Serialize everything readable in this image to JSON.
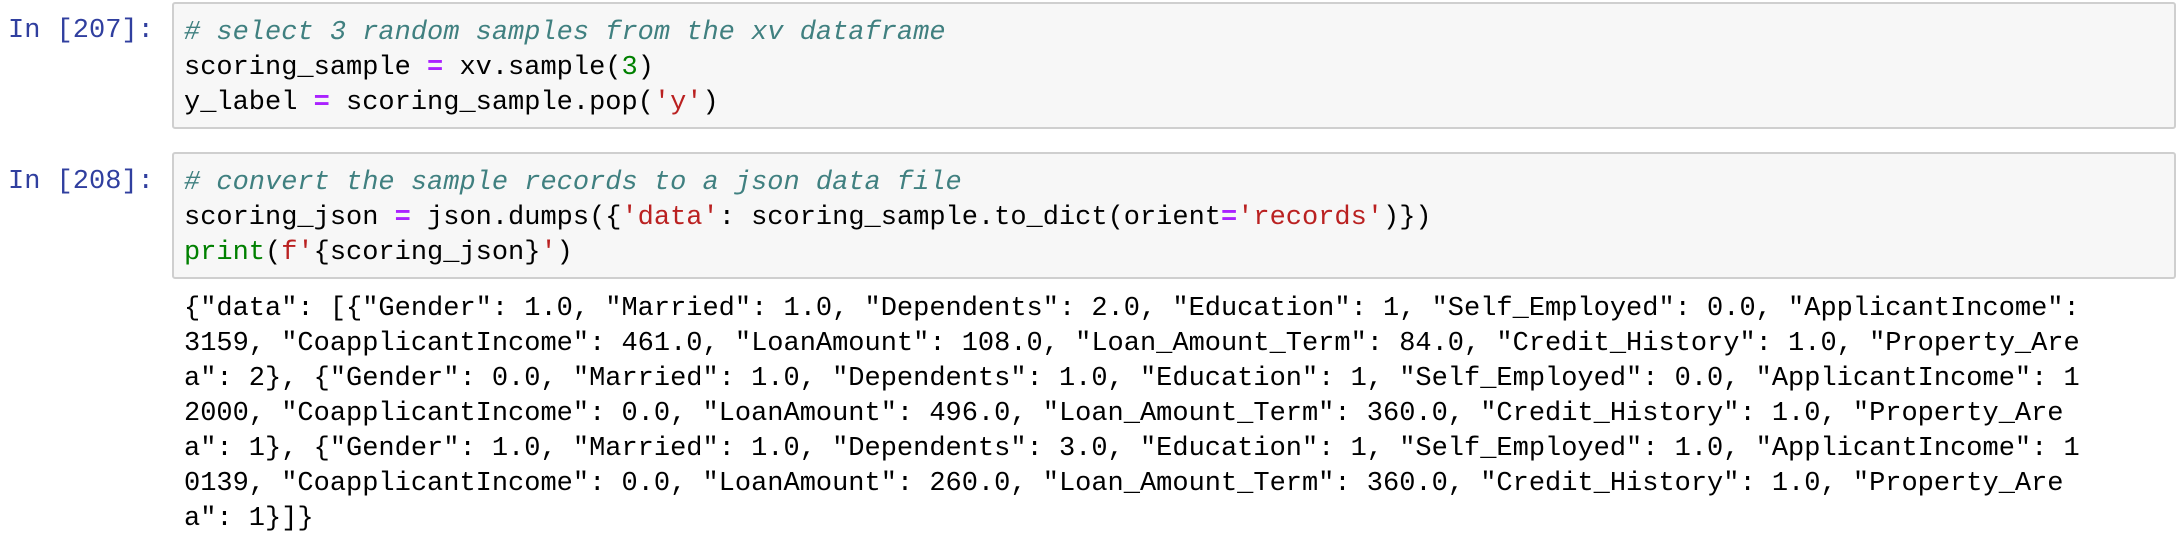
{
  "cells": [
    {
      "prompt": "In [207]:",
      "lines": [
        [
          {
            "t": "comment",
            "v": "# select 3 random samples from the xv dataframe"
          }
        ],
        [
          {
            "t": "plain",
            "v": "scoring_sample "
          },
          {
            "t": "op",
            "v": "="
          },
          {
            "t": "plain",
            "v": " xv.sample("
          },
          {
            "t": "num",
            "v": "3"
          },
          {
            "t": "plain",
            "v": ")"
          }
        ],
        [
          {
            "t": "plain",
            "v": "y_label "
          },
          {
            "t": "op",
            "v": "="
          },
          {
            "t": "plain",
            "v": " scoring_sample.pop("
          },
          {
            "t": "str",
            "v": "'y'"
          },
          {
            "t": "plain",
            "v": ")"
          }
        ]
      ]
    },
    {
      "prompt": "In [208]:",
      "lines": [
        [
          {
            "t": "comment",
            "v": "# convert the sample records to a json data file"
          }
        ],
        [
          {
            "t": "plain",
            "v": "scoring_json "
          },
          {
            "t": "op",
            "v": "="
          },
          {
            "t": "plain",
            "v": " json.dumps({"
          },
          {
            "t": "str",
            "v": "'data'"
          },
          {
            "t": "plain",
            "v": ": scoring_sample.to_dict(orient"
          },
          {
            "t": "op",
            "v": "="
          },
          {
            "t": "str",
            "v": "'records'"
          },
          {
            "t": "plain",
            "v": ")})"
          }
        ],
        [
          {
            "t": "builtin",
            "v": "print"
          },
          {
            "t": "plain",
            "v": "("
          },
          {
            "t": "str",
            "v": "f'"
          },
          {
            "t": "plain",
            "v": "{scoring_json}"
          },
          {
            "t": "str",
            "v": "'"
          },
          {
            "t": "plain",
            "v": ")"
          }
        ]
      ]
    }
  ],
  "output": [
    "{\"data\": [{\"Gender\": 1.0, \"Married\": 1.0, \"Dependents\": 2.0, \"Education\": 1, \"Self_Employed\": 0.0, \"ApplicantIncome\":",
    "3159, \"CoapplicantIncome\": 461.0, \"LoanAmount\": 108.0, \"Loan_Amount_Term\": 84.0, \"Credit_History\": 1.0, \"Property_Are",
    "a\": 2}, {\"Gender\": 0.0, \"Married\": 1.0, \"Dependents\": 1.0, \"Education\": 1, \"Self_Employed\": 0.0, \"ApplicantIncome\": 1",
    "2000, \"CoapplicantIncome\": 0.0, \"LoanAmount\": 496.0, \"Loan_Amount_Term\": 360.0, \"Credit_History\": 1.0, \"Property_Are",
    "a\": 1}, {\"Gender\": 1.0, \"Married\": 1.0, \"Dependents\": 3.0, \"Education\": 1, \"Self_Employed\": 1.0, \"ApplicantIncome\": 1",
    "0139, \"CoapplicantIncome\": 0.0, \"LoanAmount\": 260.0, \"Loan_Amount_Term\": 360.0, \"Credit_History\": 1.0, \"Property_Are",
    "a\": 1}]}"
  ],
  "colors": {
    "prompt": "#303F9F",
    "comment": "#408080",
    "operator": "#AA22FF",
    "string": "#BA2121",
    "number": "#008000",
    "cell_bg": "#f7f7f7",
    "cell_border": "#cfcfcf"
  }
}
